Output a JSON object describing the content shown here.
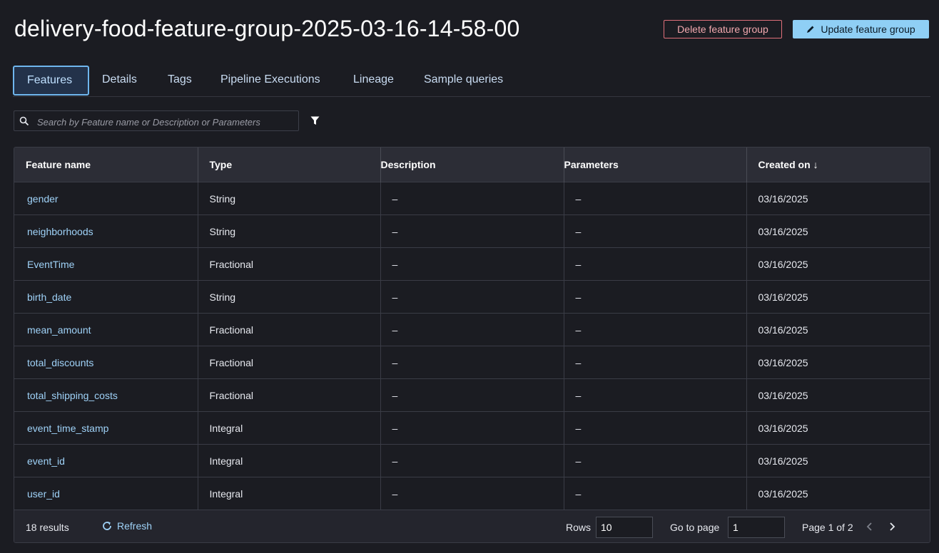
{
  "header": {
    "title": "delivery-food-feature-group-2025-03-16-14-58-00",
    "delete_label": "Delete feature group",
    "update_label": "Update feature group"
  },
  "tabs": [
    {
      "label": "Features",
      "active": true
    },
    {
      "label": "Details"
    },
    {
      "label": "Tags"
    },
    {
      "label": "Pipeline Executions"
    },
    {
      "label": "Lineage"
    },
    {
      "label": "Sample queries"
    }
  ],
  "search": {
    "placeholder": "Search by Feature name or Description or Parameters"
  },
  "table": {
    "columns": [
      "Feature name",
      "Type",
      "Description",
      "Parameters",
      "Created on"
    ],
    "sort_arrow": "↓",
    "rows": [
      {
        "name": "gender",
        "type": "String",
        "description": "–",
        "parameters": "–",
        "created": "03/16/2025"
      },
      {
        "name": "neighborhoods",
        "type": "String",
        "description": "–",
        "parameters": "–",
        "created": "03/16/2025"
      },
      {
        "name": "EventTime",
        "type": "Fractional",
        "description": "–",
        "parameters": "–",
        "created": "03/16/2025"
      },
      {
        "name": "birth_date",
        "type": "String",
        "description": "–",
        "parameters": "–",
        "created": "03/16/2025"
      },
      {
        "name": "mean_amount",
        "type": "Fractional",
        "description": "–",
        "parameters": "–",
        "created": "03/16/2025"
      },
      {
        "name": "total_discounts",
        "type": "Fractional",
        "description": "–",
        "parameters": "–",
        "created": "03/16/2025"
      },
      {
        "name": "total_shipping_costs",
        "type": "Fractional",
        "description": "–",
        "parameters": "–",
        "created": "03/16/2025"
      },
      {
        "name": "event_time_stamp",
        "type": "Integral",
        "description": "–",
        "parameters": "–",
        "created": "03/16/2025"
      },
      {
        "name": "event_id",
        "type": "Integral",
        "description": "–",
        "parameters": "–",
        "created": "03/16/2025"
      },
      {
        "name": "user_id",
        "type": "Integral",
        "description": "–",
        "parameters": "–",
        "created": "03/16/2025"
      }
    ]
  },
  "footer": {
    "results": "18 results",
    "refresh_label": "Refresh",
    "rows_label": "Rows",
    "rows_value": "10",
    "goto_label": "Go to page",
    "goto_value": "1",
    "page_of": "Page 1 of 2"
  },
  "colors": {
    "background": "#1b1c22",
    "accent": "#8fcff5",
    "link": "#9fd2f8",
    "danger": "#e0707a"
  }
}
